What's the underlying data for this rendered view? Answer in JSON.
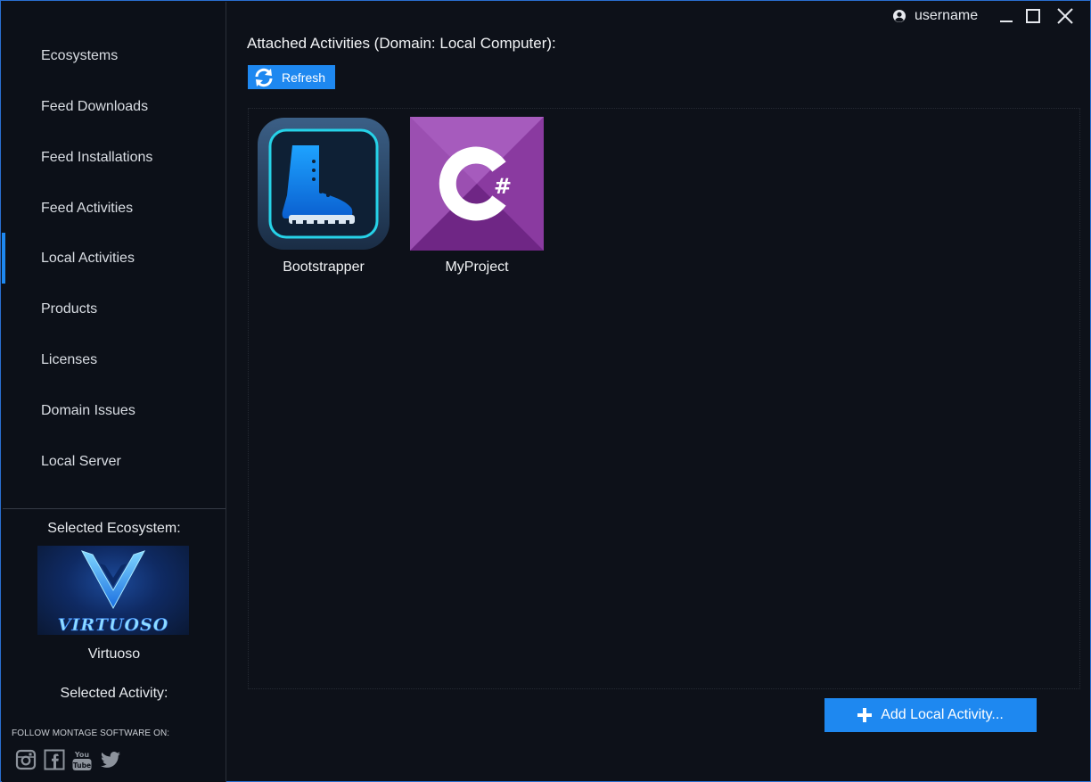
{
  "titlebar": {
    "username": "username",
    "user_icon": "user-icon",
    "minimize_icon": "minimize-icon",
    "maximize_icon": "maximize-icon",
    "close_icon": "close-icon"
  },
  "sidebar": {
    "items": [
      {
        "label": "Ecosystems"
      },
      {
        "label": "Feed Downloads"
      },
      {
        "label": "Feed Installations"
      },
      {
        "label": "Feed Activities"
      },
      {
        "label": "Local Activities",
        "active": true
      },
      {
        "label": "Products"
      },
      {
        "label": "Licenses"
      },
      {
        "label": "Domain Issues"
      },
      {
        "label": "Local Server"
      }
    ],
    "selected_ecosystem_label": "Selected Ecosystem:",
    "ecosystem_logo_text": "VIRTUOSO",
    "ecosystem_name": "Virtuoso",
    "selected_activity_label": "Selected Activity:",
    "follow_label": "FOLLOW MONTAGE SOFTWARE ON:",
    "social_icons": [
      "instagram-icon",
      "facebook-icon",
      "youtube-icon",
      "twitter-icon"
    ]
  },
  "main": {
    "title": "Attached Activities (Domain: Local Computer):",
    "refresh_label": "Refresh",
    "activities": [
      {
        "name": "Bootstrapper",
        "icon": "boot-icon"
      },
      {
        "name": "MyProject",
        "icon": "csharp-icon"
      }
    ],
    "add_button_label": "Add Local Activity..."
  },
  "colors": {
    "accent": "#1e88f0",
    "background": "#0d1119",
    "sidebar": "#0c1018",
    "csharp_purple": "#953dac"
  }
}
